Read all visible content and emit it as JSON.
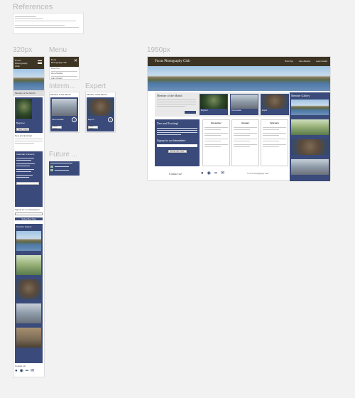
{
  "labels": {
    "references": "References",
    "w320": "320px",
    "menu": "Menu",
    "intermediate": "Interm...",
    "expert": "Expert",
    "future": "Future ...",
    "w1950": "1950px"
  },
  "site": {
    "title": "Focus Photography Club",
    "title_short": "Focus Photography Club",
    "nav": [
      "Photo Tips",
      "Join a Member",
      "Learn Contact"
    ],
    "member_month": "Member of the Month",
    "member_gallery": "Member Gallery",
    "new_exciting": "New and Exciting!",
    "signup": "Signup for our Newsletter!",
    "subscribe": "Subscribe Now",
    "contact": "Contact us!",
    "copyright": "© Focus Photography Club",
    "months": [
      "December",
      "January",
      "February"
    ],
    "calendar_title": "Calendar of Events",
    "beginner": "Beginner",
    "intermediate": "Intermediate",
    "expert": "Expert",
    "view_more": "View more"
  },
  "colors": {
    "header": "#3d3423",
    "navy": "#3a4a7a"
  }
}
